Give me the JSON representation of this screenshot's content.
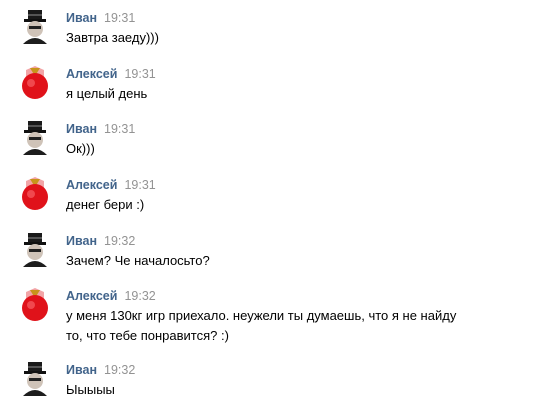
{
  "messages": [
    {
      "author": "Иван",
      "time": "19:31",
      "text": "Завтра заеду)))",
      "avatar": "ivan-avatar"
    },
    {
      "author": "Алексей",
      "time": "19:31",
      "text": "я целый день",
      "avatar": "aleksey-avatar"
    },
    {
      "author": "Иван",
      "time": "19:31",
      "text": "Ок)))",
      "avatar": "ivan-avatar"
    },
    {
      "author": "Алексей",
      "time": "19:31",
      "text": "денег бери :)",
      "avatar": "aleksey-avatar"
    },
    {
      "author": "Иван",
      "time": "19:32",
      "text": "Зачем? Че началосьто?",
      "avatar": "ivan-avatar"
    },
    {
      "author": "Алексей",
      "time": "19:32",
      "text": "у меня 130кг игр приехало. неужели ты думаешь, что я не найду то, что тебе понравится? :)",
      "avatar": "aleksey-avatar"
    },
    {
      "author": "Иван",
      "time": "19:32",
      "text": "Ыыыыы",
      "avatar": "ivan-avatar"
    }
  ],
  "colors": {
    "author": "#42648b",
    "time": "#939393",
    "text": "#000000",
    "aleksey_avatar": "#e0121a"
  }
}
